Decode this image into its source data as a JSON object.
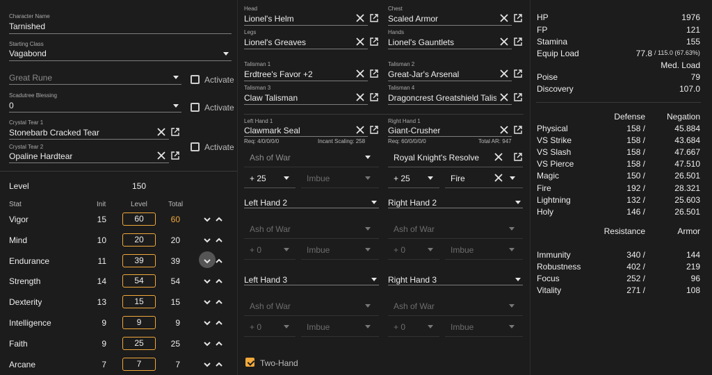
{
  "left": {
    "char_name_label": "Character Name",
    "char_name": "Tarnished",
    "class_label": "Starting Class",
    "class_value": "Vagabond",
    "great_rune_placeholder": "Great Rune",
    "activate_label": "Activate",
    "scadutree_label": "Scadutree Blessing",
    "scadutree_value": "0",
    "tear1_label": "Crystal Tear 1",
    "tear1_value": "Stonebarb Cracked Tear",
    "tear2_label": "Crystal Tear 2",
    "tear2_value": "Opaline Hardtear",
    "level_label": "Level",
    "level_value": "150",
    "stat_header": "Stat",
    "init_header": "Init",
    "level_header": "Level",
    "total_header": "Total",
    "stats": [
      {
        "name": "Vigor",
        "init": "15",
        "level": "60",
        "total": "60",
        "highlight": true
      },
      {
        "name": "Mind",
        "init": "10",
        "level": "20",
        "total": "20",
        "highlight": false
      },
      {
        "name": "Endurance",
        "init": "11",
        "level": "39",
        "total": "39",
        "highlight": false
      },
      {
        "name": "Strength",
        "init": "14",
        "level": "54",
        "total": "54",
        "highlight": false
      },
      {
        "name": "Dexterity",
        "init": "13",
        "level": "15",
        "total": "15",
        "highlight": false
      },
      {
        "name": "Intelligence",
        "init": "9",
        "level": "9",
        "total": "9",
        "highlight": false
      },
      {
        "name": "Faith",
        "init": "9",
        "level": "25",
        "total": "25",
        "highlight": false
      },
      {
        "name": "Arcane",
        "init": "7",
        "level": "7",
        "total": "7",
        "highlight": false
      }
    ]
  },
  "armor": {
    "head_label": "Head",
    "head": "Lionel's Helm",
    "chest_label": "Chest",
    "chest": "Scaled Armor",
    "legs_label": "Legs",
    "legs": "Lionel's Greaves",
    "hands_label": "Hands",
    "hands": "Lionel's Gauntlets",
    "tal1_label": "Talisman 1",
    "tal1": "Erdtree's Favor +2",
    "tal2_label": "Talisman 2",
    "tal2": "Great-Jar's Arsenal",
    "tal3_label": "Talisman 3",
    "tal3": "Claw Talisman",
    "tal4_label": "Talisman 4",
    "tal4": "Dragoncrest Greatshield Talisman"
  },
  "weapons": {
    "lh1_label": "Left Hand 1",
    "lh1": "Clawmark Seal",
    "lh1_req": "Req: 4/0/0/0/0",
    "lh1_scaling": "Incant Scaling: 258",
    "rh1_label": "Right Hand 1",
    "rh1": "Giant-Crusher",
    "rh1_req": "Req: 60/0/0/0/0",
    "rh1_ar": "Total AR: 947",
    "ash_placeholder": "Ash of War",
    "rh1_ash": "Royal Knight's Resolve",
    "lh1_upgrade": "+ 25",
    "rh1_upgrade": "+ 25",
    "imbue_placeholder": "Imbue",
    "rh1_imbue": "Fire",
    "lh2": "Left Hand 2",
    "rh2": "Right Hand 2",
    "lh3": "Left Hand 3",
    "rh3": "Right Hand 3",
    "zero_upgrade": "+ 0",
    "two_hand_label": "Two-Hand"
  },
  "stats_panel": {
    "hp_label": "HP",
    "hp": "1976",
    "fp_label": "FP",
    "fp": "121",
    "stamina_label": "Stamina",
    "stamina": "155",
    "equip_label": "Equip Load",
    "equip_value": "77.8",
    "equip_detail": "/ 115.0 (67.63%)",
    "equip_class": "Med. Load",
    "poise_label": "Poise",
    "poise": "79",
    "discovery_label": "Discovery",
    "discovery": "107.0",
    "defense_header": "Defense",
    "negation_header": "Negation",
    "defenses": [
      {
        "name": "Physical",
        "def": "158 /",
        "neg": "45.884"
      },
      {
        "name": "VS Strike",
        "def": "158 /",
        "neg": "43.684"
      },
      {
        "name": "VS Slash",
        "def": "158 /",
        "neg": "47.667"
      },
      {
        "name": "VS Pierce",
        "def": "158 /",
        "neg": "47.510"
      },
      {
        "name": "Magic",
        "def": "150 /",
        "neg": "26.501"
      },
      {
        "name": "Fire",
        "def": "192 /",
        "neg": "28.321"
      },
      {
        "name": "Lightning",
        "def": "132 /",
        "neg": "25.603"
      },
      {
        "name": "Holy",
        "def": "146 /",
        "neg": "26.501"
      }
    ],
    "resistance_header": "Resistance",
    "armor_header": "Armor",
    "resistances": [
      {
        "name": "Immunity",
        "res": "340 /",
        "armor": "144"
      },
      {
        "name": "Robustness",
        "res": "402 /",
        "armor": "219"
      },
      {
        "name": "Focus",
        "res": "252 /",
        "armor": "96"
      },
      {
        "name": "Vitality",
        "res": "271 /",
        "armor": "108"
      }
    ]
  },
  "colors": {
    "accent": "#f2a93b",
    "background": "#1c1c1c"
  }
}
